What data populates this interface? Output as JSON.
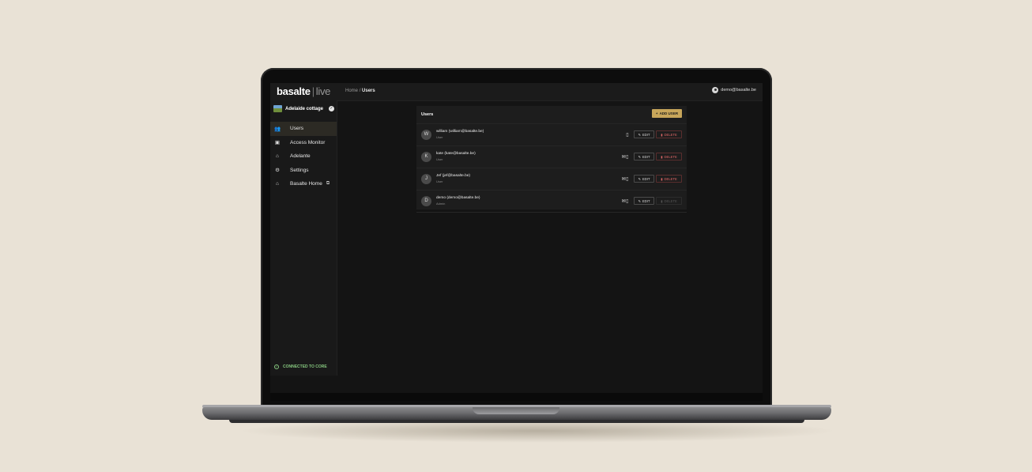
{
  "app": {
    "logo": "basalte",
    "logo_suffix": "live"
  },
  "header": {
    "breadcrumb_root": "Home",
    "breadcrumb_sep": "/",
    "breadcrumb_current": "Users",
    "user_email": "demo@basalte.be"
  },
  "sidebar": {
    "house_name": "Adelaide cottage",
    "items": [
      {
        "label": "Users",
        "icon": "users-icon",
        "glyph": "👥",
        "active": true
      },
      {
        "label": "Access Monitor",
        "icon": "monitor-icon",
        "glyph": "▣"
      },
      {
        "label": "Adelante",
        "icon": "home-outline-icon",
        "glyph": "⌂"
      },
      {
        "label": "Settings",
        "icon": "gear-icon",
        "glyph": "⚙"
      },
      {
        "label": "Basalte Home",
        "icon": "home-icon",
        "glyph": "⌂",
        "external": true
      }
    ],
    "status": "CONNECTED TO CORE"
  },
  "panel": {
    "title": "Users",
    "add_label": "ADD USER",
    "edit_label": "EDIT",
    "delete_label": "DELETE",
    "users": [
      {
        "initial": "W",
        "name": "william (william@basalte.be)",
        "role": "User",
        "icons": "▯"
      },
      {
        "initial": "K",
        "name": "kate (kate@basalte.be)",
        "role": "User",
        "icons": "✉▯"
      },
      {
        "initial": "J",
        "name": "Jef (jef@basalte.be)",
        "role": "User",
        "icons": "✉▯"
      },
      {
        "initial": "D",
        "name": "demo (demo@basalte.be)",
        "role": "Admin",
        "icons": "✉▯"
      }
    ]
  },
  "colors": {
    "accent": "#c8a65a",
    "danger": "#e06666",
    "success": "#86c77f",
    "background": "#e9e2d6"
  }
}
